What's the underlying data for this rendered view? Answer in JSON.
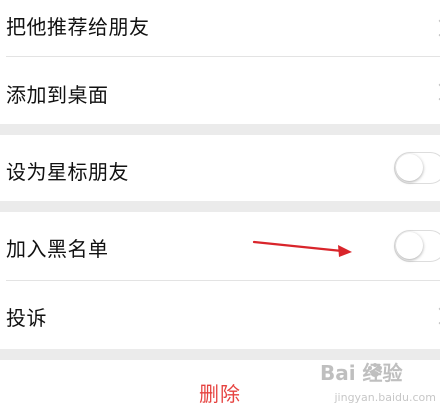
{
  "settings": {
    "recommend_label": "把他推荐给朋友",
    "add_to_desktop_label": "添加到桌面",
    "star_friend_label": "设为星标朋友",
    "star_friend_enabled": false,
    "blacklist_label": "加入黑名单",
    "blacklist_enabled": false,
    "complain_label": "投诉",
    "delete_label": "删除"
  },
  "watermark": {
    "logo_text": "Bai 经验",
    "url_text": "jingyan.baidu.com"
  },
  "colors": {
    "background": "#ebebeb",
    "row": "#ffffff",
    "delete": "#e64340",
    "arrow": "#d9252b"
  }
}
